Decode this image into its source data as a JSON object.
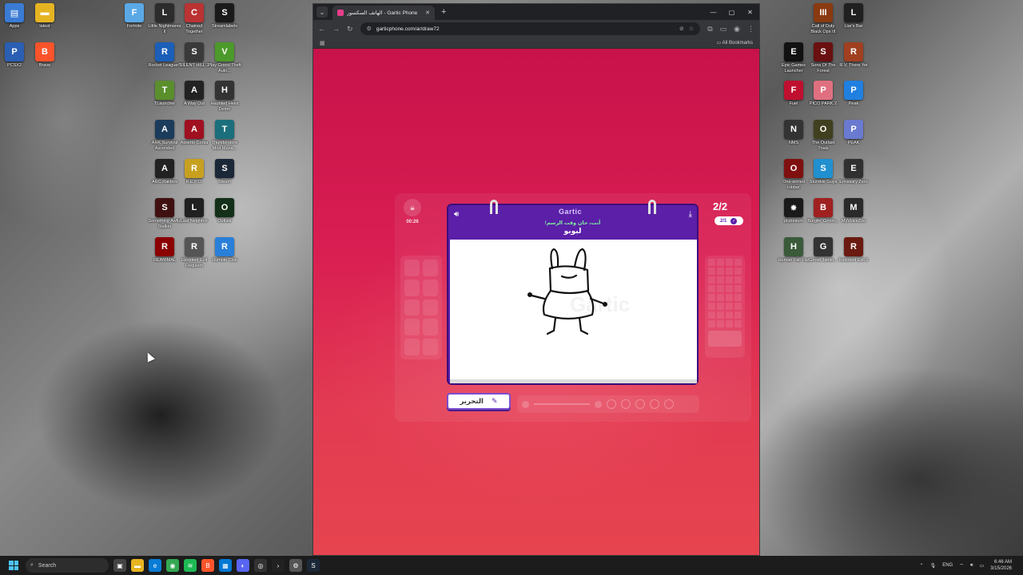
{
  "desktop": {
    "left_icons": [
      {
        "label": "Apps",
        "color": "#3a7bd5",
        "glyph": "▤"
      },
      {
        "label": "latest",
        "color": "#e6b422",
        "glyph": "▬"
      },
      {
        "label": "PCSX2",
        "color": "#2b5fb3",
        "glyph": "P"
      },
      {
        "label": "Brave",
        "color": "#fb542b",
        "glyph": "B"
      },
      {
        "label": "Fortnite",
        "color": "#5aa9e6",
        "glyph": "F"
      },
      {
        "label": "Little Nightmares II",
        "color": "#2c2c2c",
        "glyph": "L"
      },
      {
        "label": "Chained Together",
        "color": "#b33",
        "glyph": "C"
      },
      {
        "label": "Streamlabels",
        "color": "#1a1a1a",
        "glyph": "S"
      },
      {
        "label": "Rocket League®",
        "color": "#1b5fb8",
        "glyph": "R"
      },
      {
        "label": "SILENT HILL 2",
        "color": "#3a3a3a",
        "glyph": "S"
      },
      {
        "label": "Play Grand Theft Auto...",
        "color": "#4c9a2a",
        "glyph": "V"
      },
      {
        "label": "TLauncher",
        "color": "#5a8f2c",
        "glyph": "T"
      },
      {
        "label": "A Way Out",
        "color": "#222",
        "glyph": "A"
      },
      {
        "label": "Haunted Heist Demo",
        "color": "#333",
        "glyph": "H"
      },
      {
        "label": "ARK Survival Ascended",
        "color": "#1c3c5c",
        "glyph": "A"
      },
      {
        "label": "Assetto Corsa",
        "color": "#a01020",
        "glyph": "A"
      },
      {
        "label": "Thunderstore Mod Mana...",
        "color": "#1b6f7c",
        "glyph": "T"
      },
      {
        "label": "ARC Raiders",
        "color": "#222",
        "glyph": "A"
      },
      {
        "label": "R.E.P.O.",
        "color": "#c8a020",
        "glyph": "R"
      },
      {
        "label": "Steam",
        "color": "#1b2838",
        "glyph": "S"
      },
      {
        "label": "Something Awful Stalker",
        "color": "#401010",
        "glyph": "S"
      },
      {
        "label": "Last Neighbor",
        "color": "#202020",
        "glyph": "L"
      },
      {
        "label": "Outlast",
        "color": "#143018",
        "glyph": "O"
      },
      {
        "label": "REANIMAL",
        "color": "#8b0000",
        "glyph": "R"
      },
      {
        "label": "Resident Evil Requiem",
        "color": "#555",
        "glyph": "R"
      },
      {
        "label": "Rumble Club",
        "color": "#2a7fd8",
        "glyph": "R"
      }
    ],
    "right_icons": [
      {
        "label": "Liar's Bar",
        "color": "#202020",
        "glyph": "L"
      },
      {
        "label": "Call of Duty Black Ops III",
        "color": "#8a3a10",
        "glyph": "III"
      },
      {
        "label": "Epic Games Launcher",
        "color": "#111",
        "glyph": "E"
      },
      {
        "label": "Sons Of The Forest",
        "color": "#6a1010",
        "glyph": "S"
      },
      {
        "label": "R.V. There Yet",
        "color": "#a04020",
        "glyph": "R"
      },
      {
        "label": "Fuel",
        "color": "#c01030",
        "glyph": "F"
      },
      {
        "label": "PICO PARK 2",
        "color": "#e07080",
        "glyph": "P"
      },
      {
        "label": "Peak",
        "color": "#2080e0",
        "glyph": "P"
      },
      {
        "label": "NMS",
        "color": "#333",
        "glyph": "N"
      },
      {
        "label": "The Outlast Trials",
        "color": "#404020",
        "glyph": "O"
      },
      {
        "label": "PEAK",
        "color": "#6a7ad0",
        "glyph": "P"
      },
      {
        "label": "One-armed robber",
        "color": "#801010",
        "glyph": "O"
      },
      {
        "label": "Stumble Guys",
        "color": "#2090d0",
        "glyph": "S"
      },
      {
        "label": "Emissary Zero",
        "color": "#303030",
        "glyph": "E"
      },
      {
        "label": "plutonium",
        "color": "#1a1a1a",
        "glyph": "✸"
      },
      {
        "label": "Burglin' Gnom...",
        "color": "#a02020",
        "glyph": "B"
      },
      {
        "label": "MyVoiceZoo",
        "color": "#2a2a2a",
        "glyph": "M"
      },
      {
        "label": "Human Fall Flat",
        "color": "#3a5a3a",
        "glyph": "H"
      },
      {
        "label": "Ghost Janito...",
        "color": "#333",
        "glyph": "G"
      },
      {
        "label": "Resident Evil 5",
        "color": "#6a1a10",
        "glyph": "R"
      }
    ]
  },
  "browser": {
    "tab_title": "الهاتف السكسور - Gartic Phone",
    "url": "garticphone.com/ar/draw72",
    "all_bookmarks": "All Bookmarks",
    "window_controls": [
      "—",
      "▢",
      "✕"
    ]
  },
  "game": {
    "timer": "00:26",
    "logo": "Gartic",
    "prompt_sub": "أنت، حان وقت الرسم!",
    "prompt_word": "لبوبو",
    "round_counter": "2/2",
    "page_indicator": "2/1",
    "edit_label": "التحرير"
  },
  "taskbar": {
    "search_placeholder": "Search",
    "lang": "ENG",
    "time": "6:46 AM",
    "date": "3/15/2026"
  }
}
